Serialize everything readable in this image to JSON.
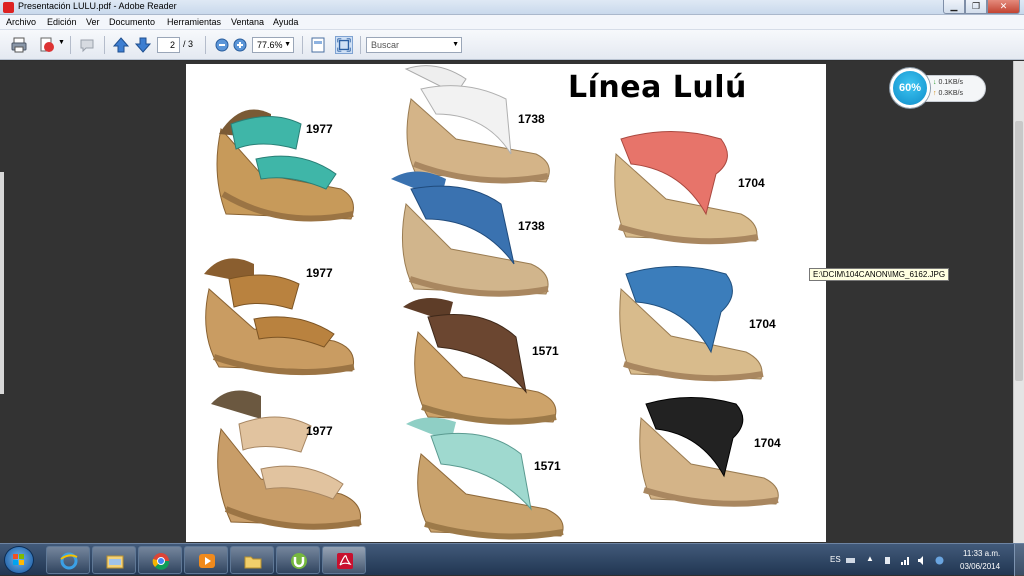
{
  "window": {
    "title": "Presentación LULU.pdf - Adobe Reader",
    "min_label": "▁",
    "max_label": "❐",
    "close_label": "✕"
  },
  "menu": {
    "items": [
      {
        "label": "Archivo"
      },
      {
        "label": "Edición"
      },
      {
        "label": "Ver"
      },
      {
        "label": "Documento"
      },
      {
        "label": "Herramientas"
      },
      {
        "label": "Ventana"
      },
      {
        "label": "Ayuda"
      }
    ]
  },
  "toolbar": {
    "page_current": "2",
    "page_total": "/ 3",
    "zoom": "77.6%",
    "search_placeholder": "Buscar",
    "icons": [
      "print-icon",
      "create-pdf-icon",
      "comment-icon",
      "page-up-icon",
      "page-down-icon",
      "zoom-out-icon",
      "zoom-in-icon",
      "fit-page-icon",
      "full-screen-icon"
    ]
  },
  "document": {
    "page_title": "Línea  Lulú",
    "products": [
      {
        "code": "1977",
        "color": "#3fb6a8"
      },
      {
        "code": "1977",
        "color": "#b9823f"
      },
      {
        "code": "1977",
        "color": "#e1c39f"
      },
      {
        "code": "1738",
        "color": "#f2f2f2"
      },
      {
        "code": "1738",
        "color": "#3a72b0"
      },
      {
        "code": "1571",
        "color": "#6b4630"
      },
      {
        "code": "1571",
        "color": "#9fd9cf"
      },
      {
        "code": "1704",
        "color": "#e7746a"
      },
      {
        "code": "1704",
        "color": "#3b7dbb"
      },
      {
        "code": "1704",
        "color": "#222222"
      }
    ]
  },
  "overlay": {
    "net_percent": "60%",
    "download_speed": "0.1KB/s",
    "upload_speed": "0.3KB/s",
    "tooltip": "E:\\DCIM\\104CANON\\IMG_6162.JPG"
  },
  "taskbar": {
    "apps": [
      "internet-explorer-icon",
      "file-explorer-icon",
      "chrome-icon",
      "media-player-icon",
      "folder-icon",
      "utorrent-icon",
      "adobe-reader-icon"
    ],
    "language": "ES",
    "time": "11:33 a.m.",
    "date": "03/06/2014"
  }
}
